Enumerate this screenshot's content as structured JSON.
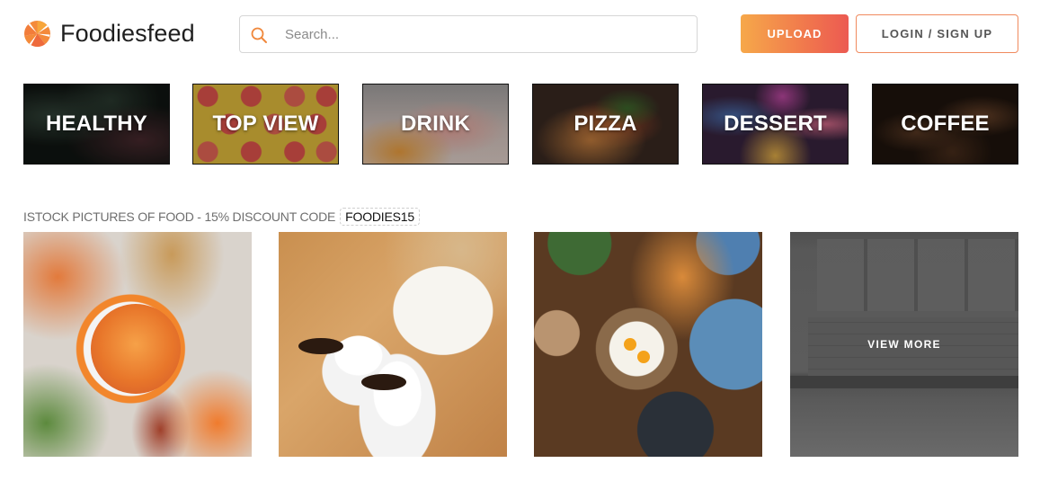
{
  "header": {
    "logo_text": "Foodiesfeed",
    "search_placeholder": "Search...",
    "upload_label": "UPLOAD",
    "login_label": "LOGIN / SIGN UP"
  },
  "categories": [
    {
      "label": "HEALTHY"
    },
    {
      "label": "TOP VIEW"
    },
    {
      "label": "DRINK"
    },
    {
      "label": "PIZZA"
    },
    {
      "label": "DESSERT"
    },
    {
      "label": "COFFEE"
    }
  ],
  "promo": {
    "text": "ISTOCK PICTURES OF FOOD - 15% DISCOUNT CODE",
    "code": "FOODIES15"
  },
  "photos": {
    "view_more_label": "VIEW MORE"
  },
  "colors": {
    "accent_start": "#f6a84a",
    "accent_end": "#ec5a52",
    "logo_orange": "#f0823c"
  },
  "icons": [
    "foodiesfeed-logo-icon",
    "search-icon"
  ]
}
